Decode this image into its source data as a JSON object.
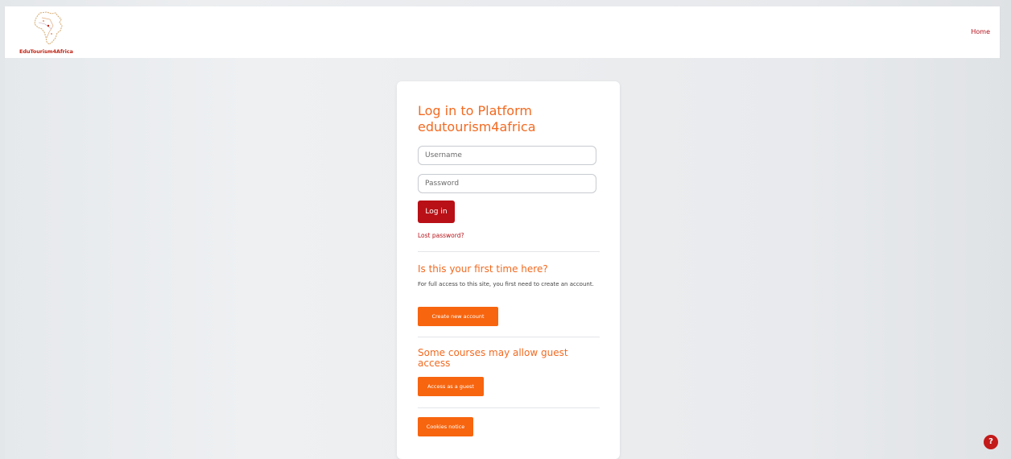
{
  "brand": {
    "logo_text": "EduTourism4Africa"
  },
  "nav": {
    "home_label": "Home"
  },
  "login": {
    "title": "Log in to Platform edutourism4africa",
    "username_placeholder": "Username",
    "username_value": "",
    "password_placeholder": "Password",
    "password_value": "",
    "login_button": "Log in",
    "lost_password": "Lost password?"
  },
  "signup": {
    "heading": "Is this your first time here?",
    "text": "For full access to this site, you first need to create an account.",
    "button": "Create new account"
  },
  "guest": {
    "heading": "Some courses may allow guest access",
    "button": "Access as a guest"
  },
  "cookies": {
    "button": "Cookies notice"
  },
  "help": {
    "icon_glyph": "?"
  },
  "colors": {
    "accent_orange": "#f26a21",
    "button_orange": "#f7650f",
    "brand_red": "#b81016"
  }
}
